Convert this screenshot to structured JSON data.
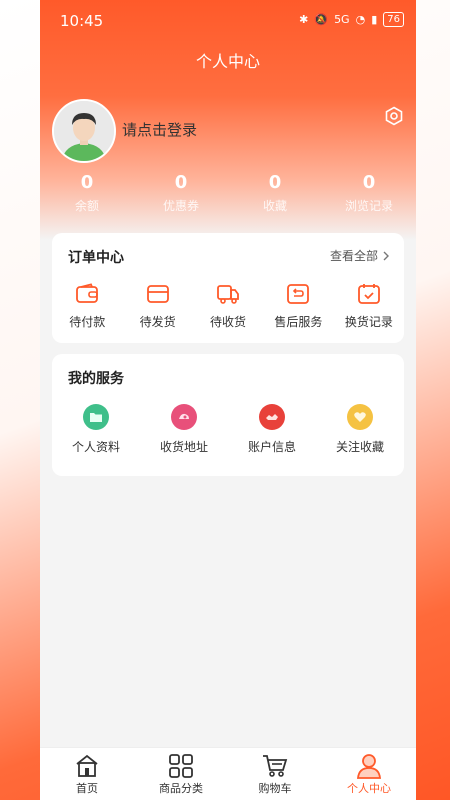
{
  "status_bar": {
    "time": "10:45",
    "network": "5G",
    "battery": "76"
  },
  "header": {
    "title": "个人中心"
  },
  "profile": {
    "login_prompt": "请点击登录"
  },
  "stats": [
    {
      "value": "0",
      "label": "余额"
    },
    {
      "value": "0",
      "label": "优惠券"
    },
    {
      "value": "0",
      "label": "收藏"
    },
    {
      "value": "0",
      "label": "浏览记录"
    }
  ],
  "orders": {
    "title": "订单中心",
    "view_all": "查看全部",
    "items": [
      {
        "label": "待付款",
        "icon": "wallet-icon"
      },
      {
        "label": "待发货",
        "icon": "box-icon"
      },
      {
        "label": "待收货",
        "icon": "truck-icon"
      },
      {
        "label": "售后服务",
        "icon": "return-icon"
      },
      {
        "label": "换货记录",
        "icon": "calendar-check-icon"
      }
    ]
  },
  "services": {
    "title": "我的服务",
    "items": [
      {
        "label": "个人资料",
        "icon": "folder-icon",
        "color": "#3fbf8a"
      },
      {
        "label": "收货地址",
        "icon": "location-icon",
        "color": "#e8507a"
      },
      {
        "label": "账户信息",
        "icon": "account-icon",
        "color": "#e8413a"
      },
      {
        "label": "关注收藏",
        "icon": "heart-icon",
        "color": "#f5c242"
      }
    ]
  },
  "tabbar": [
    {
      "label": "首页",
      "icon": "home-icon",
      "active": false
    },
    {
      "label": "商品分类",
      "icon": "grid-icon",
      "active": false
    },
    {
      "label": "购物车",
      "icon": "cart-icon",
      "active": false
    },
    {
      "label": "个人中心",
      "icon": "user-icon",
      "active": true
    }
  ],
  "colors": {
    "accent": "#ff5a2a",
    "background": "#f4f4f4"
  }
}
